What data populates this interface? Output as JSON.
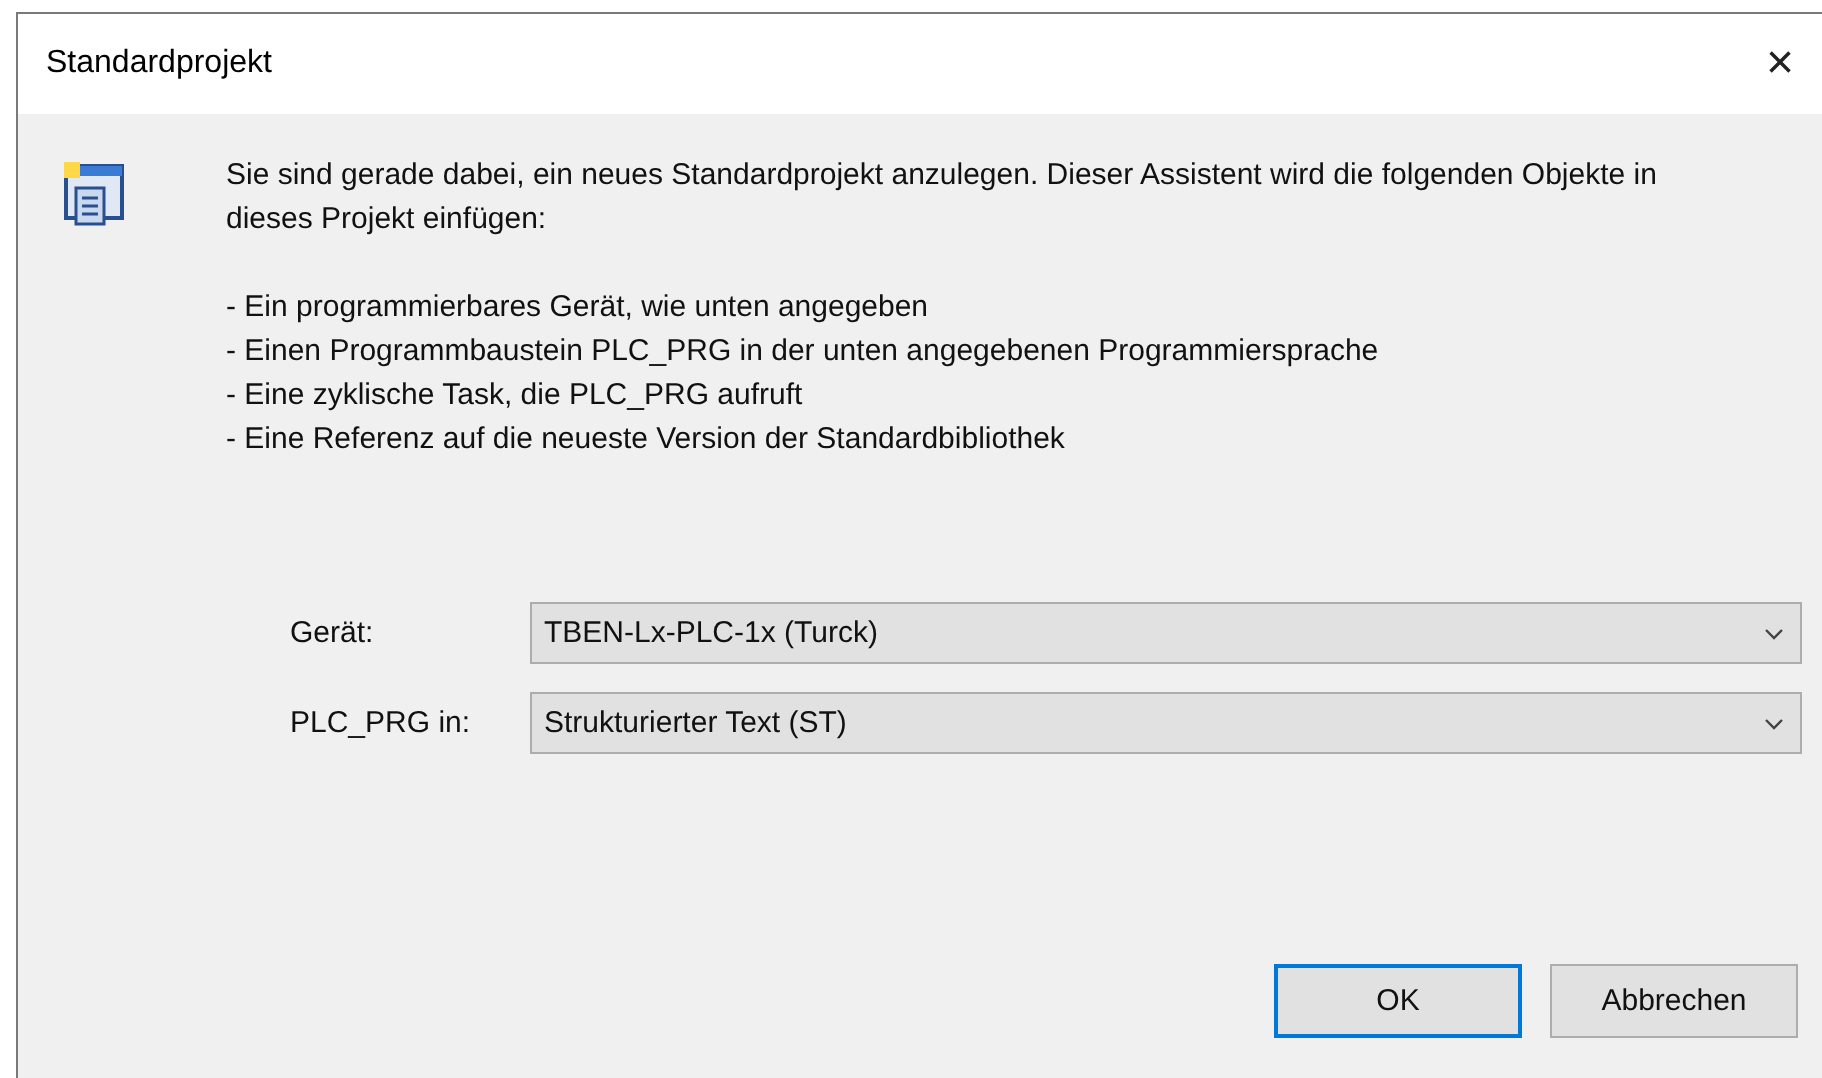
{
  "window": {
    "title": "Standardprojekt",
    "close": "×"
  },
  "intro": "Sie sind gerade dabei, ein neues Standardprojekt anzulegen. Dieser Assistent wird die folgenden Objekte in dieses Projekt einfügen:",
  "items": [
    "- Ein programmierbares Gerät, wie unten angegeben",
    "- Einen Programmbaustein PLC_PRG in der unten angegebenen Programmiersprache",
    "- Eine zyklische Task, die PLC_PRG aufruft",
    "- Eine Referenz auf die neueste Version der Standardbibliothek"
  ],
  "fields": [
    {
      "label": "Gerät:",
      "value": "TBEN-Lx-PLC-1x (Turck)"
    },
    {
      "label": "PLC_PRG in:",
      "value": "Strukturierter Text (ST)"
    }
  ],
  "buttons": [
    {
      "label": "OK",
      "default": true
    },
    {
      "label": "Abbrechen",
      "default": false
    }
  ]
}
